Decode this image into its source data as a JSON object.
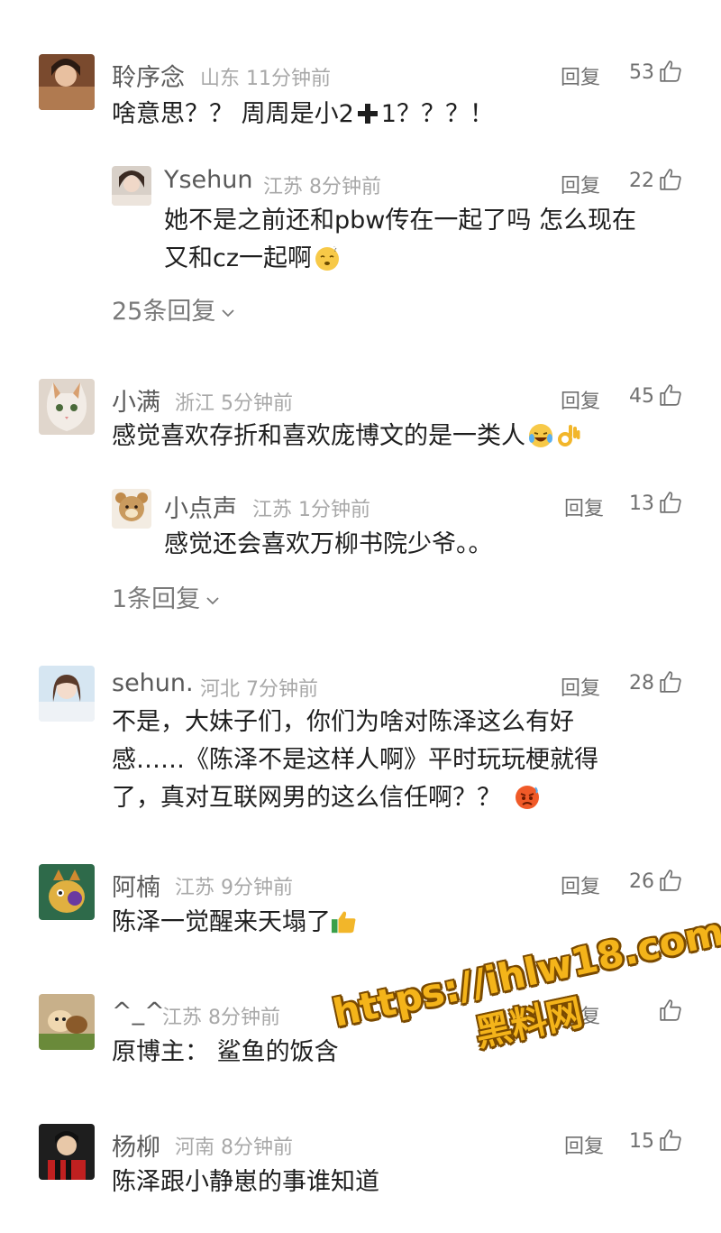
{
  "comments": [
    {
      "user": "聆序念",
      "location": "山东",
      "time": "11分钟前",
      "reply_label": "回复",
      "likes": "53",
      "text_a": "啥意思？？ 周周是小2",
      "text_b": "1？？？！",
      "replies": [
        {
          "user": "Ysehun",
          "location": "江苏",
          "time": "8分钟前",
          "reply_label": "回复",
          "likes": "22",
          "line1": "她不是之前还和pbw传在一起了吗 怎么现在",
          "line2": "又和cz一起啊"
        }
      ],
      "more_replies": "25条回复"
    },
    {
      "user": "小满",
      "location": "浙江",
      "time": "5分钟前",
      "reply_label": "回复",
      "likes": "45",
      "text": "感觉喜欢存折和喜欢庞博文的是一类人",
      "replies": [
        {
          "user": "小点声",
          "location": "江苏",
          "time": "1分钟前",
          "reply_label": "回复",
          "likes": "13",
          "text": "感觉还会喜欢万柳书院少爷。。"
        }
      ],
      "more_replies": "1条回复"
    },
    {
      "user": "sehun.",
      "location": "河北",
      "time": "7分钟前",
      "reply_label": "回复",
      "likes": "28",
      "line1": "不是，大妹子们，你们为啥对陈泽这么有好",
      "line2": "感……《陈泽不是这样人啊》平时玩玩梗就得",
      "line3": "了，真对互联网男的这么信任啊？？"
    },
    {
      "user": "阿楠",
      "location": "江苏",
      "time": "9分钟前",
      "reply_label": "回复",
      "likes": "26",
      "text": "陈泽一觉醒来天塌了"
    },
    {
      "user": "^_^",
      "location": "江苏",
      "time": "8分钟前",
      "reply_label": "回复",
      "text": "原博主：  鲨鱼的饭含"
    },
    {
      "user": "杨柳",
      "location": "河南",
      "time": "8分钟前",
      "reply_label": "回复",
      "likes": "15",
      "text": "陈泽跟小静崽的事谁知道"
    }
  ],
  "watermark": {
    "url": "https://ihlw18.com",
    "name": "黑料网"
  },
  "icons": {
    "like": "thumbs-up-icon",
    "chevron": "chevron-down-icon"
  },
  "colors": {
    "text": "#1e1e1e",
    "username": "#5a5a5a",
    "meta": "#a8a8a8",
    "watermark": "#f4b41a"
  }
}
